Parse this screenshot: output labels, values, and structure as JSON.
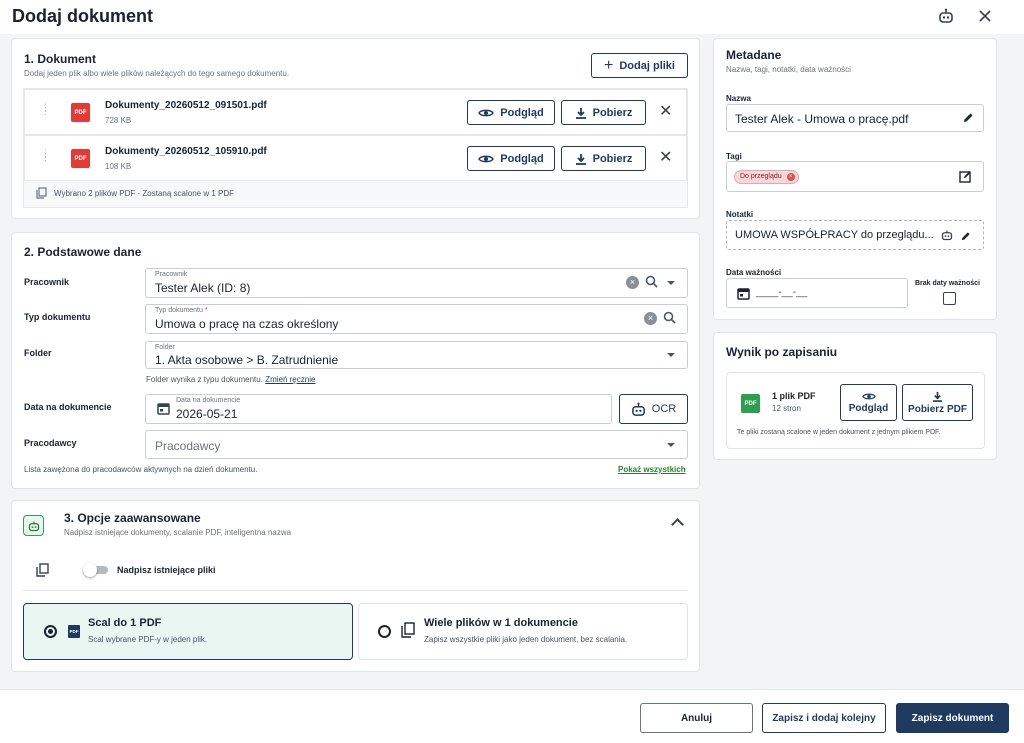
{
  "header": {
    "title": "Dodaj dokument",
    "assistant_icon": "robot-icon",
    "close_icon": "close-icon"
  },
  "document": {
    "title": "1. Dokument",
    "subtitle": "Dodaj jeden plik albo wiele plików należących do tego samego dokumentu.",
    "add_files_label": "Dodaj pliki",
    "files": [
      {
        "name": "Dokumenty_20260512_091501.pdf",
        "size": "728 KB",
        "type": "PDF"
      },
      {
        "name": "Dokumenty_20260512_105910.pdf",
        "size": "108 KB",
        "type": "PDF"
      }
    ],
    "preview_label": "Podgląd",
    "download_label": "Pobierz",
    "summary": "Wybrano 2 plików PDF · Zostaną scalone w 1 PDF"
  },
  "basic": {
    "title": "2. Podstawowe dane",
    "employee": {
      "label": "Pracownik",
      "float_label": "Pracownik",
      "value": "Tester Alek (ID: 8)"
    },
    "doc_type": {
      "label": "Typ dokumentu",
      "float_label": "Typ dokumentu",
      "required_mark": "*",
      "value": "Umowa o pracę na czas określony"
    },
    "folder": {
      "label": "Folder",
      "float_label": "Folder",
      "value": "1. Akta osobowe > B. Zatrudnienie",
      "hint": "Folder wynika z typu dokumentu.",
      "hint_link": "Zmień ręcznie"
    },
    "doc_date": {
      "label": "Data na dokumencie",
      "float_label": "Data na dokumencie",
      "value": "2026-05-21",
      "ocr_label": "OCR"
    },
    "employers": {
      "label": "Pracodawcy",
      "placeholder": "Pracodawcy",
      "hint": "Lista zawężona do pracodawców aktywnych na dzień dokumentu.",
      "show_all": "Pokaż wszystkich"
    }
  },
  "advanced": {
    "title": "3. Opcje zaawansowane",
    "subtitle": "Nadpisz istniejące dokumenty, scalanie PDF, inteligentna nazwa",
    "overwrite_label": "Nadpisz istniejące pliki",
    "overwrite_on": false,
    "options": [
      {
        "title": "Scal do 1 PDF",
        "desc": "Scal wybrane PDF-y w jeden plik.",
        "selected": true
      },
      {
        "title": "Wiele plików w 1 dokumencie",
        "desc": "Zapisz wszystkie pliki jako jeden dokument, bez scalania.",
        "selected": false
      }
    ]
  },
  "metadata": {
    "title": "Metadane",
    "subtitle": "Nazwa, tagi, notatki, data ważności",
    "name_label": "Nazwa",
    "name_value": "Tester Alek - Umowa o pracę.pdf",
    "tags_label": "Tagi",
    "tags": [
      "Do przeglądu"
    ],
    "notes_label": "Notatki",
    "notes_value": "UMOWA WSPÓŁPRACY do przeglądu...",
    "expiry_label": "Data ważności",
    "expiry_placeholder": "____-__-__",
    "no_expiry_label": "Brak daty ważności"
  },
  "result": {
    "title": "Wynik po zapisaniu",
    "file_count": "1 plik PDF",
    "pages": "12 stron",
    "preview_label": "Podgląd",
    "download_label": "Pobierz PDF",
    "note": "Te pliki zostaną scalone w jeden dokument z jednym plikiem PDF."
  },
  "footer": {
    "cancel": "Anuluj",
    "save_next": "Zapisz i dodaj kolejny",
    "save": "Zapisz dokument"
  },
  "colors": {
    "navy": "#1e3a5f",
    "pdf_red": "#e53935",
    "pdf_green": "#2e9e4f",
    "tag_bg": "#f8d7da",
    "link_green": "#2e7d32",
    "selected_bg": "#eaf6f1"
  }
}
